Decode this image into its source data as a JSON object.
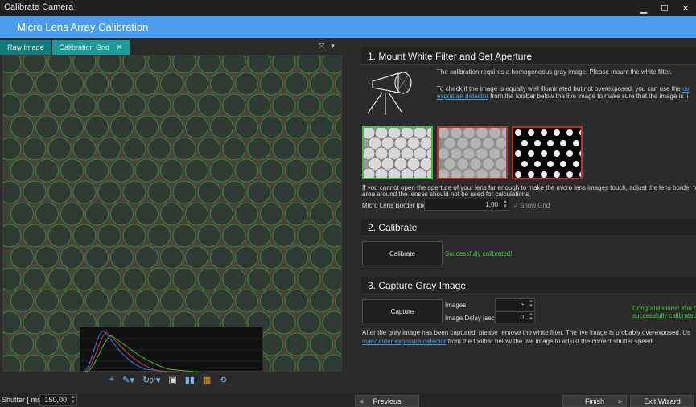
{
  "window": {
    "title": "Calibrate Camera",
    "controls": [
      "minimize-icon",
      "maximize-icon",
      "close-icon"
    ]
  },
  "banner": {
    "title": "Micro Lens Array Calibration"
  },
  "tabs": [
    {
      "label": "Raw Image",
      "active": false
    },
    {
      "label": "Calibration Grid",
      "active": true,
      "close": "✕"
    }
  ],
  "view_toolbar": {
    "icons": [
      "crosshair-icon",
      "eyedropper-icon",
      "rotate-icon",
      "image-icon",
      "histogram-icon",
      "grid-icon",
      "refresh-icon"
    ],
    "rotation_value": "0°"
  },
  "shutter": {
    "label": "Shutter [ ms ]",
    "value": "150,00"
  },
  "nav": {
    "previous": "Previous",
    "finish": "Finish",
    "exit": "Exit Wizard"
  },
  "step1": {
    "title": "1. Mount White Filter and Set Aperture",
    "text1": "The calibration requires a homogeneous gray image. Please mount the white filter.",
    "text2_a": "To check if the image is equally well illuminated but not overexposed, you can use the ",
    "text2_link_a": "ov",
    "text2_link_b": "exposure detector",
    "text2_b": " from the toolbar below the live image to make sure that the image is li",
    "thumb_colors": [
      "#3fbf3f",
      "#c03030",
      "#c03030"
    ],
    "hint_line1": "If you cannot open the aperture of your lens far enough to make the micro lens images touch, adjust the lens border to tell the softwa",
    "hint_line2": "area around the lenses should not be used for calculations.",
    "border_label": "Micro Lens Border [px]",
    "border_value": "1,00",
    "show_grid_label": "Show Grid"
  },
  "step2": {
    "title": "2. Calibrate",
    "button": "Calibrate",
    "status": "Successfully calibrated!"
  },
  "step3": {
    "title": "3. Capture Gray Image",
    "button": "Capture",
    "images_label": "Images",
    "images_value": "5",
    "delay_label": "Image Delay [sec]",
    "delay_value": "0",
    "congrats_line1": "Congratulations! You hav",
    "congrats_line2": "successfully calibrated yo",
    "after_line1": "After the gray image has been captured, please remove the white filter. The live image is probably overexposed. Us",
    "after_link": "over/under exposure detector",
    "after_line2": " from the toolbar below the live image to adjust the correct shutter speed."
  },
  "colors": {
    "banner": "#4b9ded",
    "tab": "#157c7c",
    "tab_active": "#1b9a9a",
    "success": "#46c446",
    "link": "#3aa0e8"
  }
}
